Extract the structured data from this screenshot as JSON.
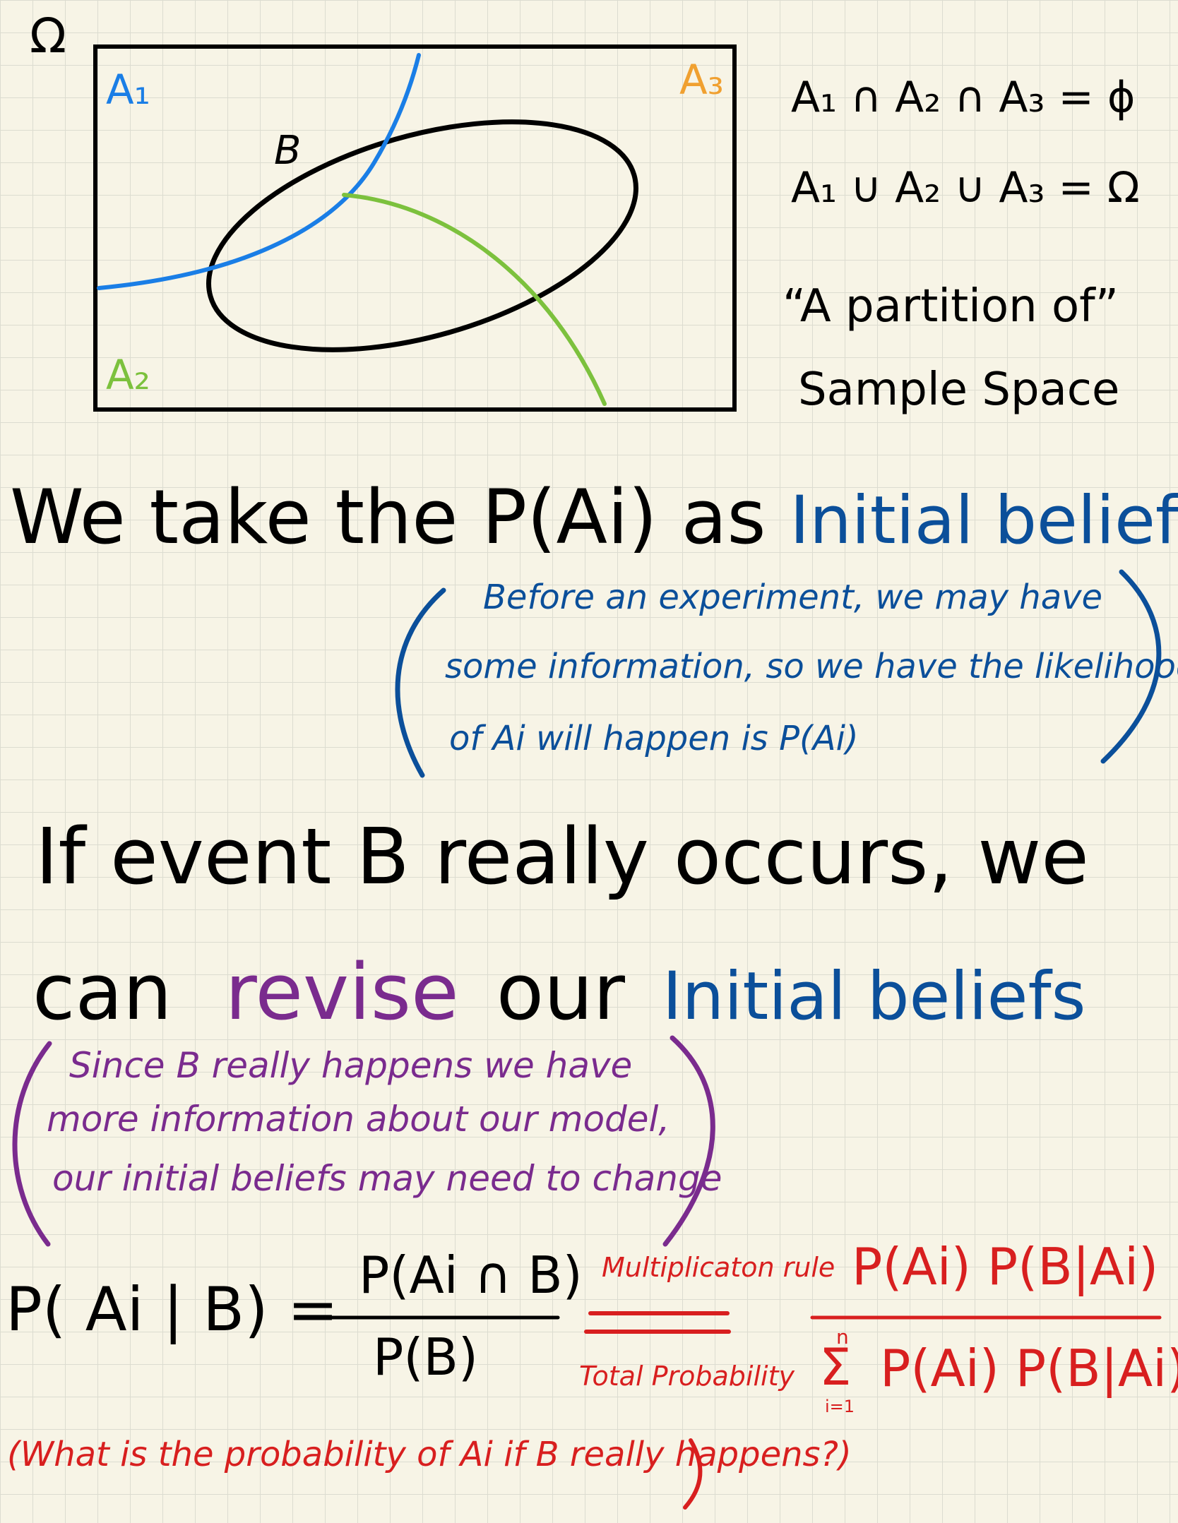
{
  "colors": {
    "ink": "#000000",
    "a1_blue": "#1a7ee6",
    "a2_green": "#7cc13d",
    "a3_orange": "#f0a030",
    "note_blue": "#0b4f9a",
    "revise_purple": "#7a2b8e",
    "formula_red": "#d81f1f"
  },
  "diagram": {
    "omega": "Ω",
    "a1": "A₁",
    "a2": "A₂",
    "a3": "A₃",
    "b": "B"
  },
  "side_notes": {
    "intersection": "A₁ ∩ A₂ ∩ A₃ = ϕ",
    "union": "A₁ ∪ A₂ ∪ A₃ = Ω",
    "partition_line1": "“A partition of”",
    "partition_line2": "Sample Space"
  },
  "line1": {
    "text": "We take the P(Ai) as",
    "highlight": "Initial beliefs"
  },
  "note1": {
    "line1": "Before an experiment, we may have",
    "line2": "some information, so we have the likelihood",
    "line3": "of Ai will happen is P(Ai)"
  },
  "line2": {
    "text": "If event B really occurs, we"
  },
  "line3": {
    "can": "can",
    "revise": "revise",
    "our": "our",
    "highlight": "Initial beliefs"
  },
  "note2": {
    "line1": "Since B really happens we have",
    "line2": "more information about our model,",
    "line3": "our initial beliefs may need to change"
  },
  "formula": {
    "lhs": "P( Ai | B) =",
    "numerator": "P(Ai ∩ B)",
    "denominator": "P(B)",
    "rule_top": "Multiplicaton rule",
    "rule_bottom": "Total Probability",
    "rhs_numerator": "P(Ai) P(B|Ai)",
    "sum_symbol": "Σ",
    "sum_upper": "n",
    "sum_lower": "i=1",
    "rhs_denominator": "P(Ai) P(B|Ai)"
  },
  "question": "(What is the probability of Ai if B really happens?)"
}
